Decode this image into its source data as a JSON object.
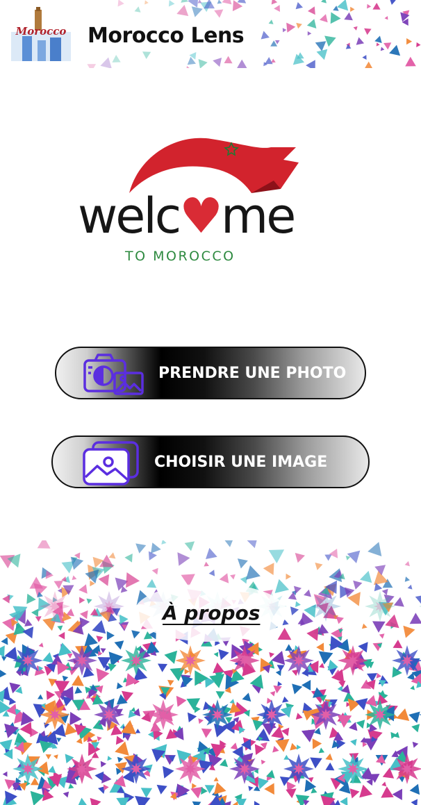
{
  "header": {
    "logo_text": "Morocco",
    "title": "Morocco Lens"
  },
  "welcome": {
    "word_pre": "welc",
    "word_heart": "♥",
    "word_post": "me",
    "subtitle": "TO MOROCCO"
  },
  "actions": {
    "take_photo": {
      "label": "PRENDRE UNE PHOTO",
      "icon": "camera-icon"
    },
    "choose_image": {
      "label": "CHOISIR UNE IMAGE",
      "icon": "gallery-icon"
    }
  },
  "footer": {
    "about_label": "À propos"
  },
  "colors": {
    "brand_red": "#d92b35",
    "brand_green": "#2e8a40",
    "icon_purple": "#5b2ee0",
    "pattern": [
      "#3d4fc6",
      "#d63b8e",
      "#2bb39a",
      "#7b3fb8",
      "#f28a3a",
      "#e25fa7",
      "#1f6fb5",
      "#48c0c8"
    ]
  }
}
